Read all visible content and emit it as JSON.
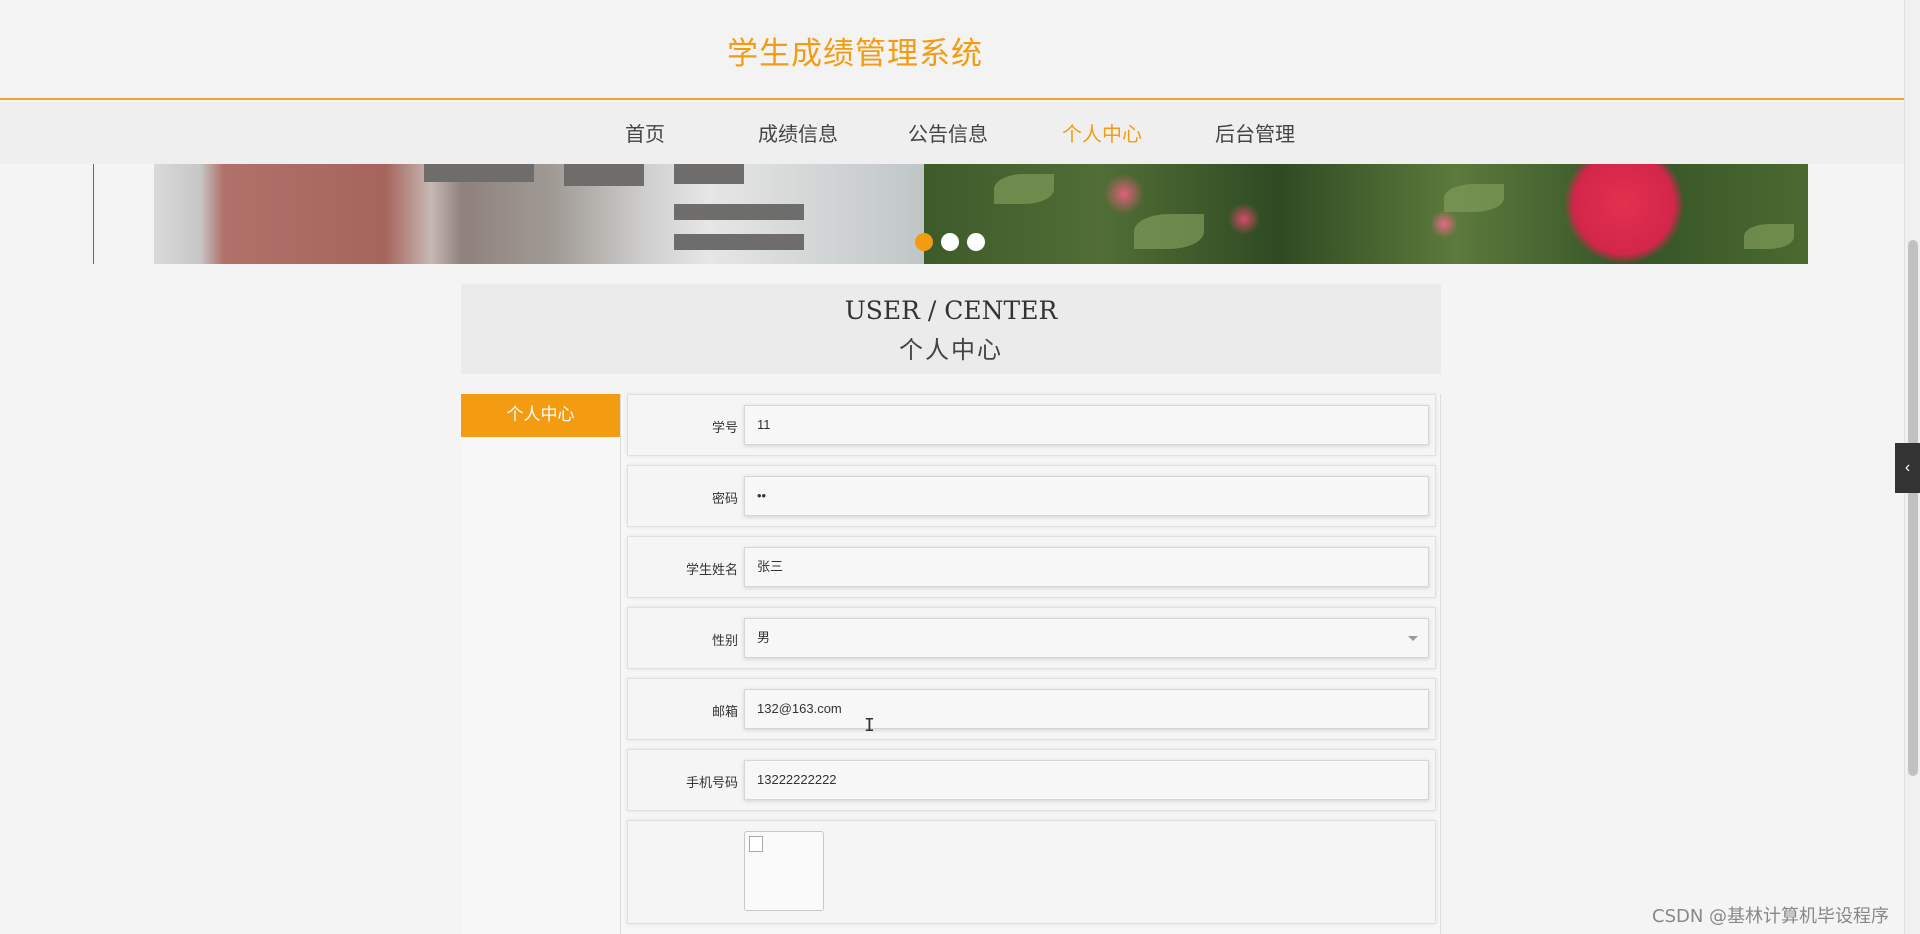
{
  "header": {
    "title": "学生成绩管理系统"
  },
  "nav": {
    "items": [
      "首页",
      "成绩信息",
      "公告信息",
      "个人中心",
      "后台管理"
    ],
    "active_index": 3
  },
  "banner": {
    "dots": 3,
    "active_dot": 0
  },
  "section": {
    "title_en": "USER / CENTER",
    "title_cn": "个人中心"
  },
  "side_menu": {
    "items": [
      "个人中心"
    ]
  },
  "form": {
    "fields": [
      {
        "label": "学号",
        "value": "11"
      },
      {
        "label": "密码",
        "value": "••"
      },
      {
        "label": "学生姓名",
        "value": "张三"
      },
      {
        "label": "性别",
        "value": "男",
        "type": "select"
      },
      {
        "label": "邮箱",
        "value": "132@163.com"
      },
      {
        "label": "手机号码",
        "value": "13222222222"
      }
    ]
  },
  "colors": {
    "accent": "#f39c12",
    "toggle_bg": "#333333"
  },
  "icons": {
    "side_toggle": "chevron-left-icon"
  },
  "watermark": "CSDN @基林计算机毕设程序"
}
